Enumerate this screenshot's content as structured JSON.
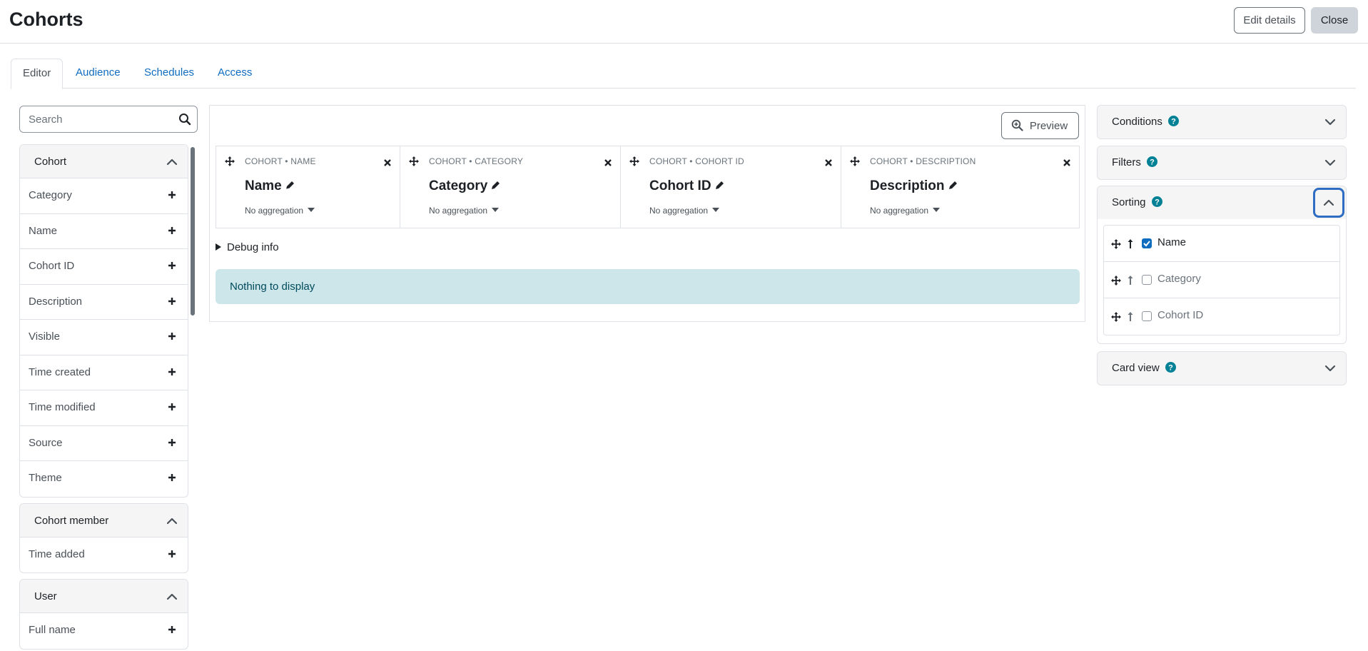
{
  "page": {
    "title": "Cohorts",
    "edit_details_label": "Edit details",
    "close_label": "Close"
  },
  "tabs": [
    {
      "label": "Editor",
      "active": true
    },
    {
      "label": "Audience"
    },
    {
      "label": "Schedules"
    },
    {
      "label": "Access"
    }
  ],
  "sidebar": {
    "search_placeholder": "Search",
    "groups": [
      {
        "title": "Cohort",
        "items": [
          "Category",
          "Name",
          "Cohort ID",
          "Description",
          "Visible",
          "Time created",
          "Time modified",
          "Source",
          "Theme"
        ]
      },
      {
        "title": "Cohort member",
        "items": [
          "Time added"
        ]
      },
      {
        "title": "User",
        "items": [
          "Full name"
        ]
      }
    ]
  },
  "editor": {
    "preview_label": "Preview",
    "columns": [
      {
        "header": "COHORT • NAME",
        "title": "Name",
        "aggregation": "No aggregation"
      },
      {
        "header": "COHORT • CATEGORY",
        "title": "Category",
        "aggregation": "No aggregation"
      },
      {
        "header": "COHORT • COHORT ID",
        "title": "Cohort ID",
        "aggregation": "No aggregation"
      },
      {
        "header": "COHORT • DESCRIPTION",
        "title": "Description",
        "aggregation": "No aggregation"
      }
    ],
    "debug_label": "Debug info",
    "empty_message": "Nothing to display"
  },
  "right_panels": {
    "conditions": {
      "title": "Conditions"
    },
    "filters": {
      "title": "Filters"
    },
    "sorting": {
      "title": "Sorting",
      "items": [
        {
          "label": "Name",
          "checked": true
        },
        {
          "label": "Category",
          "checked": false
        },
        {
          "label": "Cohort ID",
          "checked": false
        }
      ]
    },
    "card_view": {
      "title": "Card view"
    }
  },
  "colors": {
    "link": "#0f6cbf",
    "help_icon": "#008196",
    "alert_bg": "#cce6ea",
    "focus_ring": "#2f6dc3"
  },
  "icons": {
    "search": "search-icon",
    "chevron_up": "chevron-up-icon",
    "chevron_down": "chevron-down-icon",
    "plus": "plus-icon",
    "move": "move-icon",
    "remove": "close-icon",
    "edit": "pencil-icon",
    "help": "help-icon",
    "preview": "zoom-in-icon",
    "sort_direction": "arrow-up-icon"
  }
}
